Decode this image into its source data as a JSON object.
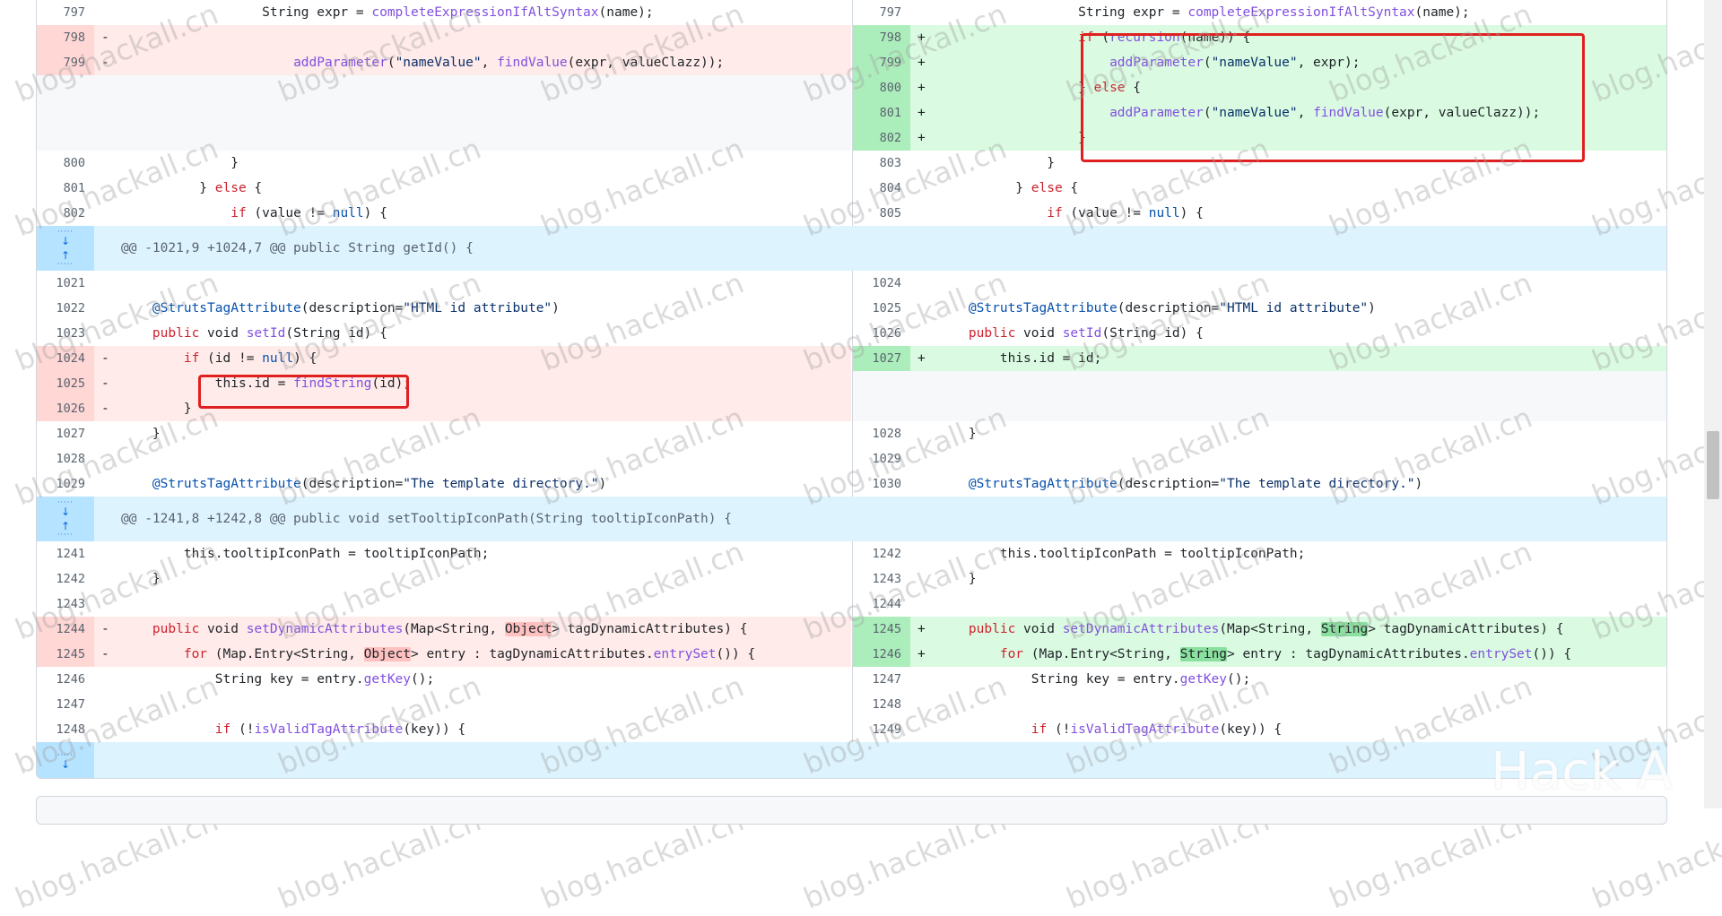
{
  "watermark_text": "blog.hackall.cn",
  "footer_watermark": "Hack A",
  "colors": {
    "deletion_bg": "#ffebe9",
    "deletion_gutter": "#ffd7d5",
    "addition_bg": "#dafbe1",
    "addition_gutter": "#aceebb",
    "hunk_bg": "#ddf4ff",
    "hunk_gutter": "#b6e3ff",
    "annotation_box": "#e02020"
  },
  "rows": [
    {
      "type": "ctx",
      "h": 28,
      "left": {
        "ln": "797",
        "code": "                  String expr = <span class=\"k-fn\">completeExpressionIfAltSyntax</span>(name);"
      },
      "right": {
        "ln": "797",
        "code": "                  String expr = <span class=\"k-fn\">completeExpressionIfAltSyntax</span>(name);"
      }
    },
    {
      "type": "change",
      "h": 28,
      "left": {
        "kind": "del",
        "ln": "798",
        "sign": "-",
        "code": ""
      },
      "right": {
        "kind": "add",
        "ln": "798",
        "sign": "+",
        "code": "                  <span class=\"k-red\">if</span> (<span class=\"k-fn\">recursion</span>(name)) {"
      }
    },
    {
      "type": "change",
      "h": 28,
      "left": {
        "kind": "del",
        "ln": "799",
        "sign": "-",
        "code": "                      <span class=\"k-fn\">addParameter</span>(<span class=\"k-str\">\"nameValue\"</span>, <span class=\"k-fn\">findValue</span>(expr, valueClazz));"
      },
      "right": {
        "kind": "add",
        "ln": "799",
        "sign": "+",
        "code": "                      <span class=\"k-fn\">addParameter</span>(<span class=\"k-str\">\"nameValue\"</span>, expr);"
      }
    },
    {
      "type": "change",
      "h": 28,
      "left": {
        "kind": "empty",
        "ln": "",
        "sign": "",
        "code": ""
      },
      "right": {
        "kind": "add",
        "ln": "800",
        "sign": "+",
        "code": "                  } <span class=\"k-red\">else</span> {"
      }
    },
    {
      "type": "change",
      "h": 28,
      "left": {
        "kind": "empty",
        "ln": "",
        "sign": "",
        "code": ""
      },
      "right": {
        "kind": "add",
        "ln": "801",
        "sign": "+",
        "code": "                      <span class=\"k-fn\">addParameter</span>(<span class=\"k-str\">\"nameValue\"</span>, <span class=\"k-fn\">findValue</span>(expr, valueClazz));"
      }
    },
    {
      "type": "change",
      "h": 28,
      "left": {
        "kind": "empty",
        "ln": "",
        "sign": "",
        "code": ""
      },
      "right": {
        "kind": "add",
        "ln": "802",
        "sign": "+",
        "code": "                  }"
      }
    },
    {
      "type": "ctx",
      "h": 28,
      "left": {
        "ln": "800",
        "code": "              }"
      },
      "right": {
        "ln": "803",
        "code": "              }"
      }
    },
    {
      "type": "ctx",
      "h": 28,
      "left": {
        "ln": "801",
        "code": "          } <span class=\"k-red\">else</span> {"
      },
      "right": {
        "ln": "804",
        "code": "          } <span class=\"k-red\">else</span> {"
      }
    },
    {
      "type": "ctx",
      "h": 28,
      "left": {
        "ln": "802",
        "code": "              <span class=\"k-red\">if</span> (value != <span class=\"k-blue\">null</span>) {"
      },
      "right": {
        "ln": "805",
        "code": "              <span class=\"k-red\">if</span> (value != <span class=\"k-blue\">null</span>) {"
      }
    },
    {
      "type": "hunk",
      "h": 50,
      "text": "@@ -1021,9 +1024,7 @@ public String getId() {",
      "expand": [
        "up",
        "down"
      ]
    },
    {
      "type": "ctx",
      "h": 28,
      "left": {
        "ln": "1021",
        "code": ""
      },
      "right": {
        "ln": "1024",
        "code": ""
      }
    },
    {
      "type": "ctx",
      "h": 28,
      "left": {
        "ln": "1022",
        "code": "    <span class=\"k-blue\">@StrutsTagAttribute</span>(description=<span class=\"k-str\">\"HTML id attribute\"</span>)"
      },
      "right": {
        "ln": "1025",
        "code": "    <span class=\"k-blue\">@StrutsTagAttribute</span>(description=<span class=\"k-str\">\"HTML id attribute\"</span>)"
      }
    },
    {
      "type": "ctx",
      "h": 28,
      "left": {
        "ln": "1023",
        "code": "    <span class=\"k-red\">public</span> void <span class=\"k-fn\">setId</span>(String id) {"
      },
      "right": {
        "ln": "1026",
        "code": "    <span class=\"k-red\">public</span> void <span class=\"k-fn\">setId</span>(String id) {"
      }
    },
    {
      "type": "change",
      "h": 28,
      "left": {
        "kind": "del",
        "ln": "1024",
        "sign": "-",
        "code": "        <span class=\"k-red\">if</span> (id != <span class=\"k-blue\">null</span>) {"
      },
      "right": {
        "kind": "add",
        "ln": "1027",
        "sign": "+",
        "code": "        this.id = id;"
      }
    },
    {
      "type": "change",
      "h": 28,
      "left": {
        "kind": "del",
        "ln": "1025",
        "sign": "-",
        "code": "            this.id = <span class=\"k-fn\">findString</span>(id);"
      },
      "right": {
        "kind": "empty",
        "ln": "",
        "sign": "",
        "code": ""
      }
    },
    {
      "type": "change",
      "h": 28,
      "left": {
        "kind": "del",
        "ln": "1026",
        "sign": "-",
        "code": "        }"
      },
      "right": {
        "kind": "empty",
        "ln": "",
        "sign": "",
        "code": ""
      }
    },
    {
      "type": "ctx",
      "h": 28,
      "left": {
        "ln": "1027",
        "code": "    }"
      },
      "right": {
        "ln": "1028",
        "code": "    }"
      }
    },
    {
      "type": "ctx",
      "h": 28,
      "left": {
        "ln": "1028",
        "code": ""
      },
      "right": {
        "ln": "1029",
        "code": ""
      }
    },
    {
      "type": "ctx",
      "h": 28,
      "left": {
        "ln": "1029",
        "code": "    <span class=\"k-blue\">@StrutsTagAttribute</span>(description=<span class=\"k-str\">\"The template directory.\"</span>)"
      },
      "right": {
        "ln": "1030",
        "code": "    <span class=\"k-blue\">@StrutsTagAttribute</span>(description=<span class=\"k-str\">\"The template directory.\"</span>)"
      }
    },
    {
      "type": "hunk",
      "h": 50,
      "text": "@@ -1241,8 +1242,8 @@ public void setTooltipIconPath(String tooltipIconPath) {",
      "expand": [
        "up",
        "down"
      ]
    },
    {
      "type": "ctx",
      "h": 28,
      "left": {
        "ln": "1241",
        "code": "        this.tooltipIconPath = tooltipIconPath;"
      },
      "right": {
        "ln": "1242",
        "code": "        this.tooltipIconPath = tooltipIconPath;"
      }
    },
    {
      "type": "ctx",
      "h": 28,
      "left": {
        "ln": "1242",
        "code": "    }"
      },
      "right": {
        "ln": "1243",
        "code": "    }"
      }
    },
    {
      "type": "ctx",
      "h": 28,
      "left": {
        "ln": "1243",
        "code": ""
      },
      "right": {
        "ln": "1244",
        "code": ""
      }
    },
    {
      "type": "change",
      "h": 28,
      "left": {
        "kind": "del",
        "ln": "1244",
        "sign": "-",
        "code": "    <span class=\"k-red\">public</span> void <span class=\"k-fn\">setDynamicAttributes</span>(Map&lt;String, <span class=\"hl-del\">Object</span>&gt; tagDynamicAttributes) {"
      },
      "right": {
        "kind": "add",
        "ln": "1245",
        "sign": "+",
        "code": "    <span class=\"k-red\">public</span> void <span class=\"k-fn\">setDynamicAttributes</span>(Map&lt;String, <span class=\"hl-add\">String</span>&gt; tagDynamicAttributes) {"
      }
    },
    {
      "type": "change",
      "h": 28,
      "left": {
        "kind": "del",
        "ln": "1245",
        "sign": "-",
        "code": "        <span class=\"k-red\">for</span> (Map.Entry&lt;String, <span class=\"hl-del\">Object</span>&gt; entry : tagDynamicAttributes.<span class=\"k-fn\">entrySet</span>()) {"
      },
      "right": {
        "kind": "add",
        "ln": "1246",
        "sign": "+",
        "code": "        <span class=\"k-red\">for</span> (Map.Entry&lt;String, <span class=\"hl-add\">String</span>&gt; entry : tagDynamicAttributes.<span class=\"k-fn\">entrySet</span>()) {"
      }
    },
    {
      "type": "ctx",
      "h": 28,
      "left": {
        "ln": "1246",
        "code": "            String key = entry.<span class=\"k-fn\">getKey</span>();"
      },
      "right": {
        "ln": "1247",
        "code": "            String key = entry.<span class=\"k-fn\">getKey</span>();"
      }
    },
    {
      "type": "ctx",
      "h": 28,
      "left": {
        "ln": "1247",
        "code": ""
      },
      "right": {
        "ln": "1248",
        "code": ""
      }
    },
    {
      "type": "ctx",
      "h": 28,
      "left": {
        "ln": "1248",
        "code": "            <span class=\"k-red\">if</span> (!<span class=\"k-fn\">isValidTagAttribute</span>(key)) {"
      },
      "right": {
        "ln": "1249",
        "code": "            <span class=\"k-red\">if</span> (!<span class=\"k-fn\">isValidTagAttribute</span>(key)) {"
      }
    },
    {
      "type": "hunk",
      "h": 40,
      "text": "",
      "expand": [
        "down"
      ]
    }
  ]
}
